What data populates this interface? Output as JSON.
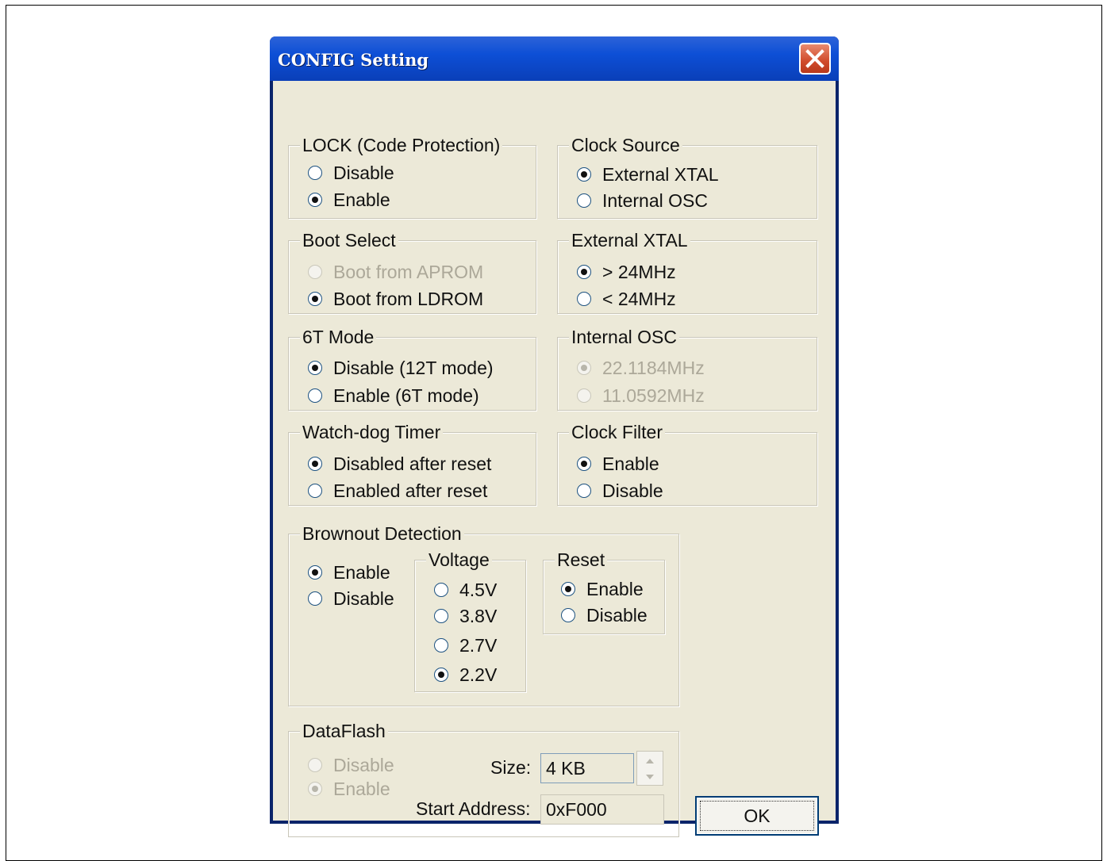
{
  "window": {
    "title": "CONFIG Setting",
    "close_glyph": "close-icon"
  },
  "lock": {
    "legend": "LOCK (Code Protection)",
    "options": [
      "Disable",
      "Enable"
    ],
    "selected": "Enable"
  },
  "clock_source": {
    "legend": "Clock Source",
    "options": [
      "External XTAL",
      "Internal OSC"
    ],
    "selected": "External XTAL"
  },
  "boot_select": {
    "legend": "Boot Select",
    "options": [
      "Boot from APROM",
      "Boot from LDROM"
    ],
    "selected": "Boot from LDROM",
    "disabled": [
      "Boot from APROM"
    ]
  },
  "external_xtal": {
    "legend": "External XTAL",
    "options": [
      "> 24MHz",
      "< 24MHz"
    ],
    "selected": "> 24MHz"
  },
  "mode_6t": {
    "legend": "6T Mode",
    "options": [
      "Disable (12T mode)",
      "Enable (6T mode)"
    ],
    "selected": "Disable (12T mode)"
  },
  "internal_osc": {
    "legend": "Internal OSC",
    "options": [
      "22.1184MHz",
      "11.0592MHz"
    ],
    "selected": "22.1184MHz",
    "disabled": [
      "22.1184MHz",
      "11.0592MHz"
    ]
  },
  "watchdog": {
    "legend": "Watch-dog Timer",
    "options": [
      "Disabled after reset",
      "Enabled after reset"
    ],
    "selected": "Disabled after reset"
  },
  "clock_filter": {
    "legend": "Clock Filter",
    "options": [
      "Enable",
      "Disable"
    ],
    "selected": "Enable"
  },
  "brownout": {
    "legend": "Brownout Detection",
    "options": [
      "Enable",
      "Disable"
    ],
    "selected": "Enable",
    "voltage": {
      "legend": "Voltage",
      "options": [
        "4.5V",
        "3.8V",
        "2.7V",
        "2.2V"
      ],
      "selected": "2.2V"
    },
    "reset": {
      "legend": "Reset",
      "options": [
        "Enable",
        "Disable"
      ],
      "selected": "Enable"
    }
  },
  "dataflash": {
    "legend": "DataFlash",
    "options": [
      "Disable",
      "Enable"
    ],
    "selected": "Enable",
    "disabled": [
      "Disable",
      "Enable"
    ],
    "size_label": "Size:",
    "size_value": "4 KB",
    "start_label": "Start Address:",
    "start_value": "0xF000"
  },
  "ok_button": {
    "label": "OK"
  },
  "colors": {
    "titlebar": "#0d4fd6",
    "dialog_bg": "#ece9d8",
    "close_bg": "#d04a2a",
    "disabled_text": "#aca899"
  }
}
